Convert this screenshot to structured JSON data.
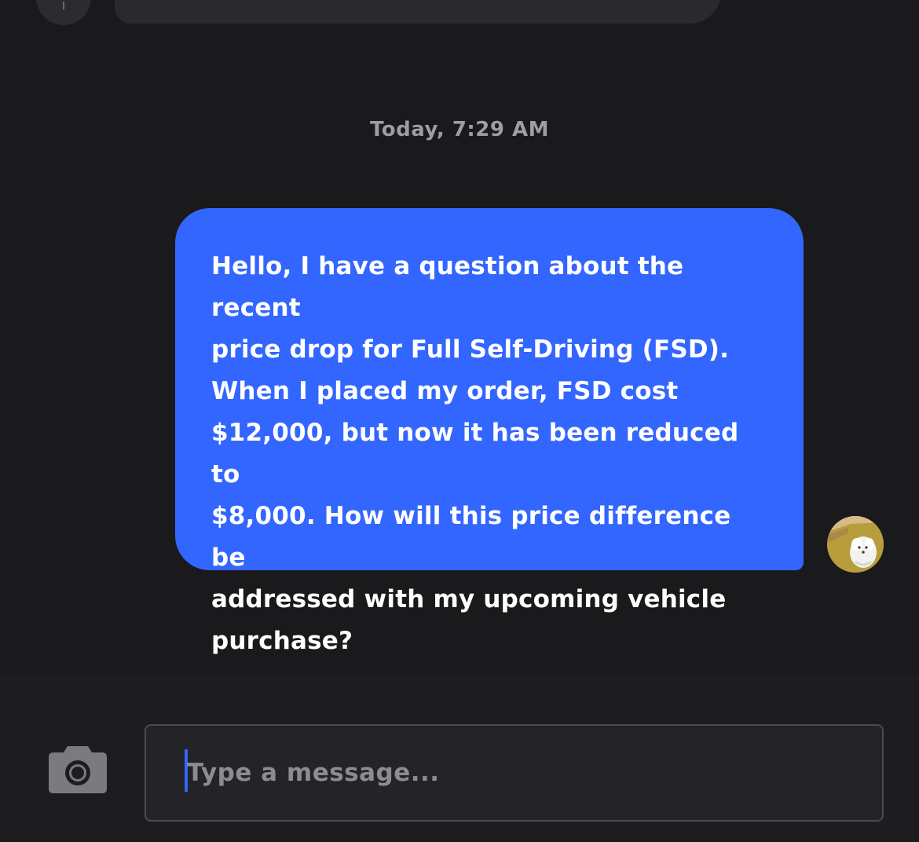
{
  "chat": {
    "timestamp": "Today, 7:29 AM",
    "messages": [
      {
        "sender": "user",
        "lines": [
          "Hello, I have a question about the recent",
          "price drop for Full Self-Driving (FSD).",
          "When I placed my order, FSD cost",
          "$12,000, but now it has been reduced to",
          "$8,000. How will this price difference be",
          "addressed with my upcoming vehicle",
          "purchase?"
        ]
      }
    ]
  },
  "composer": {
    "camera_icon": "camera-icon",
    "placeholder": "Type a message..."
  },
  "colors": {
    "background": "#1a1a1c",
    "user_bubble": "#3366ff",
    "caret": "#3366ff",
    "timestamp_text": "#9d9da2",
    "placeholder_text": "#8c8c92"
  }
}
